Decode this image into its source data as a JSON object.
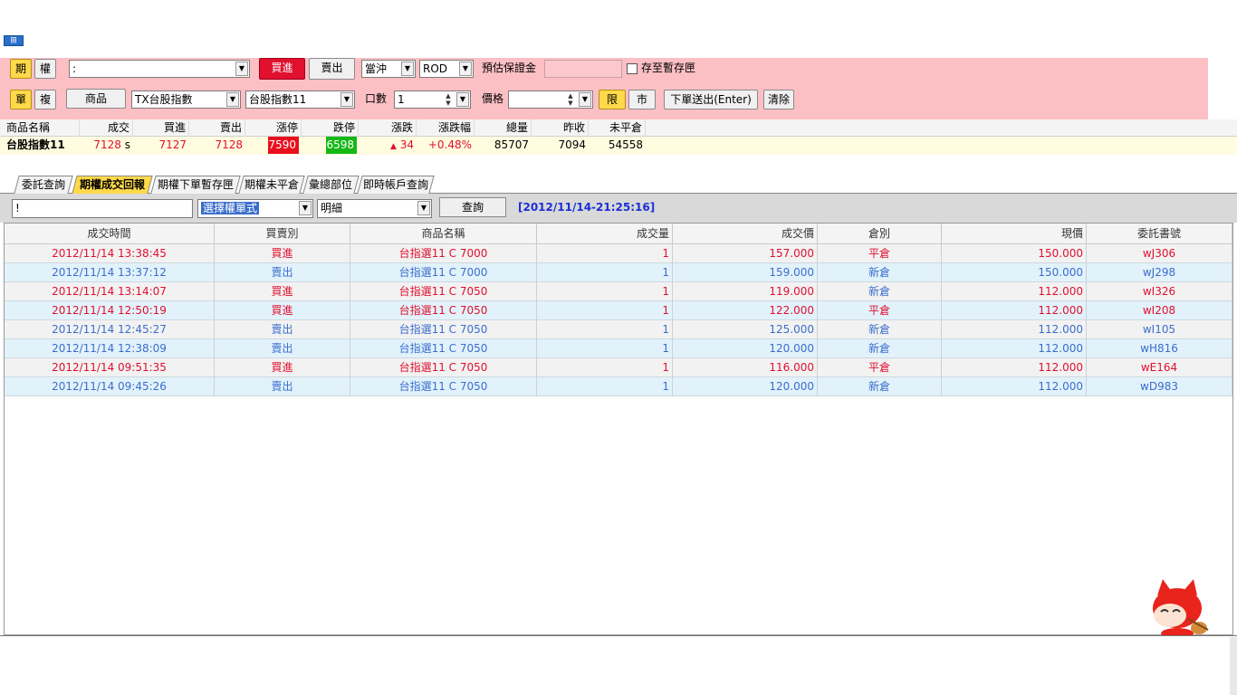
{
  "window": {
    "corner_icon": "app-window-icon"
  },
  "order": {
    "row1": {
      "futures_btn": "期",
      "options_btn": "權",
      "account_value": ":",
      "buy_btn": "買進",
      "sell_btn": "賣出",
      "daytrade_select": "當沖",
      "order_cond_select": "ROD",
      "margin_label": "預估保證金",
      "margin_value": "",
      "save_draft_label": "存至暫存匣"
    },
    "row2": {
      "single_btn": "單",
      "combo_btn": "複",
      "product_btn": "商品",
      "product_select": "TX台股指數",
      "contract_select": "台股指數11",
      "qty_label": "口數",
      "qty_value": "1",
      "price_label": "價格",
      "price_value": "",
      "limit_btn": "限",
      "market_btn": "市",
      "submit_btn": "下單送出(Enter)",
      "clear_btn": "清除"
    }
  },
  "quote": {
    "headers": [
      "商品名稱",
      "成交",
      "買進",
      "賣出",
      "漲停",
      "跌停",
      "漲跌",
      "漲跌幅",
      "總量",
      "昨收",
      "未平倉"
    ],
    "row": {
      "name": "台股指數11",
      "last": "7128",
      "last_flag": "s",
      "bid": "7127",
      "ask": "7128",
      "limit_up": "7590",
      "limit_down": "6598",
      "change": "34",
      "change_pct": "+0.48%",
      "volume": "85707",
      "prev_close": "7094",
      "open_interest": "54558"
    },
    "colors": {
      "up_bg": "#e8101e",
      "down_bg": "#16b816",
      "up_text": "#e0102e"
    }
  },
  "tabs": [
    {
      "label": "委託查詢",
      "active": false
    },
    {
      "label": "期權成交回報",
      "active": true
    },
    {
      "label": "期權下單暫存匣",
      "active": false
    },
    {
      "label": "期權未平倉",
      "active": false
    },
    {
      "label": "彙總部位",
      "active": false
    },
    {
      "label": "即時帳戶查詢",
      "active": false
    }
  ],
  "query": {
    "account_value": "!",
    "format_select": "選擇權單式",
    "detail_select": "明細",
    "query_btn": "查詢",
    "timestamp": "[2012/11/14-21:25:16]"
  },
  "fills": {
    "headers": [
      "成交時間",
      "買賣別",
      "商品名稱",
      "成交量",
      "成交價",
      "倉別",
      "現價",
      "委託書號"
    ],
    "rows": [
      {
        "time": "2012/11/14 13:38:45",
        "side": "買進",
        "product": "台指選11 C 7000",
        "qty": "1",
        "price": "157.000",
        "pos": "平倉",
        "current": "150.000",
        "order_no": "wJ306",
        "type": "buy"
      },
      {
        "time": "2012/11/14 13:37:12",
        "side": "賣出",
        "product": "台指選11 C 7000",
        "qty": "1",
        "price": "159.000",
        "pos": "新倉",
        "current": "150.000",
        "order_no": "wJ298",
        "type": "sell"
      },
      {
        "time": "2012/11/14 13:14:07",
        "side": "買進",
        "product": "台指選11 C 7050",
        "qty": "1",
        "price": "119.000",
        "pos": "新倉",
        "current": "112.000",
        "order_no": "wI326",
        "type": "buy"
      },
      {
        "time": "2012/11/14 12:50:19",
        "side": "買進",
        "product": "台指選11 C 7050",
        "qty": "1",
        "price": "122.000",
        "pos": "平倉",
        "current": "112.000",
        "order_no": "wI208",
        "type": "buy"
      },
      {
        "time": "2012/11/14 12:45:27",
        "side": "賣出",
        "product": "台指選11 C 7050",
        "qty": "1",
        "price": "125.000",
        "pos": "新倉",
        "current": "112.000",
        "order_no": "wI105",
        "type": "sell"
      },
      {
        "time": "2012/11/14 12:38:09",
        "side": "賣出",
        "product": "台指選11 C 7050",
        "qty": "1",
        "price": "120.000",
        "pos": "新倉",
        "current": "112.000",
        "order_no": "wH816",
        "type": "sell"
      },
      {
        "time": "2012/11/14 09:51:35",
        "side": "買進",
        "product": "台指選11 C 7050",
        "qty": "1",
        "price": "116.000",
        "pos": "平倉",
        "current": "112.000",
        "order_no": "wE164",
        "type": "buy"
      },
      {
        "time": "2012/11/14 09:45:26",
        "side": "賣出",
        "product": "台指選11 C 7050",
        "qty": "1",
        "price": "120.000",
        "pos": "新倉",
        "current": "112.000",
        "order_no": "wD983",
        "type": "sell"
      }
    ],
    "colors": {
      "buy": "#e0102e",
      "sell": "#3a6ecc",
      "row_odd": "#f2f2f2",
      "row_even": "#e2f2fb"
    }
  }
}
